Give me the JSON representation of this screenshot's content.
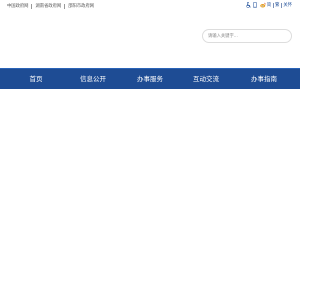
{
  "top_links": [
    {
      "label": "中国政府网"
    },
    {
      "label": "湖南省政府网"
    },
    {
      "label": "邵阳市政府网"
    }
  ],
  "top_right": {
    "accessibility_icon": "wheelchair-icon",
    "mobile_icon": "mobile-icon",
    "weibo_icon": "weibo-icon",
    "lang_simplified": "简",
    "lang_traditional": "繁",
    "lang_en": "关怀"
  },
  "search": {
    "placeholder": "请输入关键字..."
  },
  "nav": {
    "items": [
      {
        "label": "首页"
      },
      {
        "label": "信息公开"
      },
      {
        "label": "办事服务"
      },
      {
        "label": "互动交流"
      },
      {
        "label": "办事指南"
      }
    ]
  },
  "colors": {
    "nav_bg": "#1e4c94",
    "accent": "#1f4f9a"
  }
}
